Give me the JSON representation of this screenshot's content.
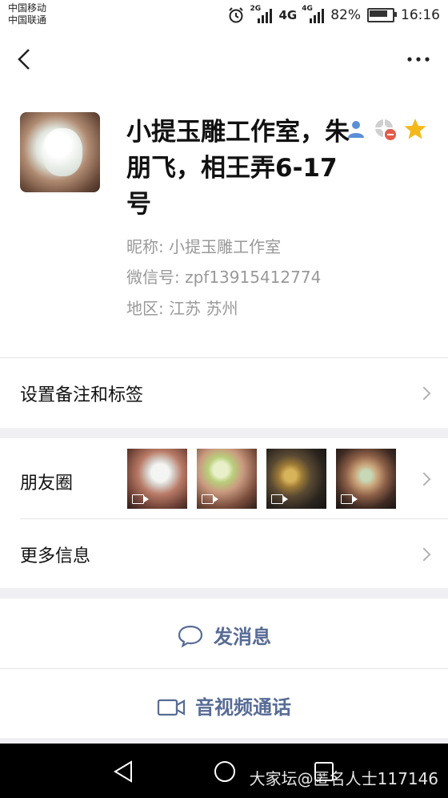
{
  "status_bar": {
    "carrier1": "中国移动",
    "carrier2": "中国联通",
    "sig1_tag": "2G",
    "sig2_label": "4G",
    "sig2_tag": "4G",
    "battery": "82%",
    "time": "16:16"
  },
  "profile": {
    "name": "小提玉雕工作室，朱朋飞，相王弄6-17号",
    "nickname": "昵称: 小提玉雕工作室",
    "wechat_id": "微信号: zpf13915412774",
    "region": "地区: 江苏  苏州"
  },
  "rows": {
    "remark_tags": "设置备注和标签",
    "moments": "朋友圈",
    "more_info": "更多信息"
  },
  "actions": {
    "send_message": "发消息",
    "video_call": "音视频通话"
  },
  "watermark": "大家坛@匿名人士117146",
  "colors": {
    "link": "#576b95",
    "divider": "#e4e4e4",
    "section_gap": "#efeff4"
  }
}
